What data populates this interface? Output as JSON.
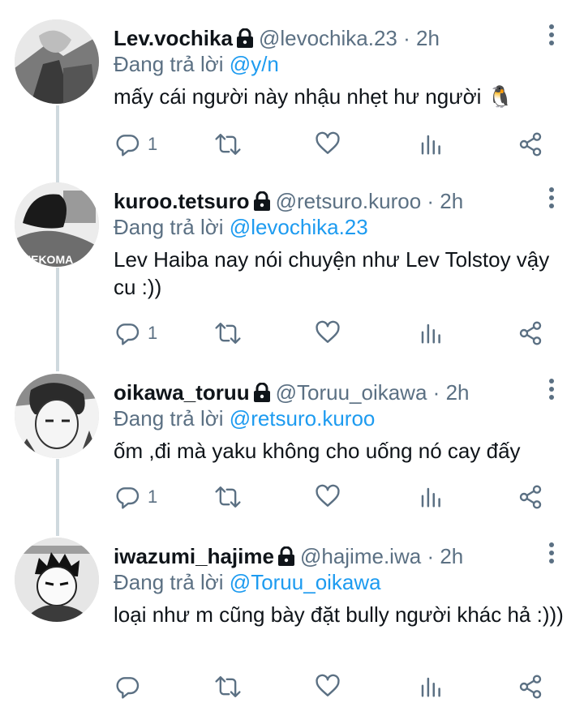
{
  "colors": {
    "accent": "#1d9bf0",
    "secondary_text": "#5b7083",
    "thread_line": "#cfd9de",
    "icon": "#5b7083"
  },
  "tweets": [
    {
      "display_name": "Lev.vochika",
      "handle": "@levochika.23",
      "separator": "·",
      "time": "2h",
      "replying_prefix": "Đang trả lời",
      "replying_to": "@y/n",
      "text": "mấy cái người này nhậu nhẹt hư người 🐧",
      "reply_count": "1",
      "icons": [
        "lock-icon",
        "more-icon",
        "reply-icon",
        "retweet-icon",
        "like-icon",
        "analytics-icon",
        "share-icon"
      ]
    },
    {
      "display_name": "kuroo.tetsuro",
      "handle": "@retsuro.kuroo",
      "separator": "·",
      "time": "2h",
      "replying_prefix": "Đang trả lời",
      "replying_to": "@levochika.23",
      "text": "Lev Haiba nay nói chuyện như Lev Tolstoy vậy cu :))",
      "reply_count": "1",
      "icons": [
        "lock-icon",
        "more-icon",
        "reply-icon",
        "retweet-icon",
        "like-icon",
        "analytics-icon",
        "share-icon"
      ]
    },
    {
      "display_name": "oikawa_toruu",
      "handle": "@Toruu_oikawa",
      "separator": "·",
      "time": "2h",
      "replying_prefix": "Đang trả lời",
      "replying_to": "@retsuro.kuroo",
      "text": "ốm ,đi mà yaku không cho uống nó cay đấy",
      "reply_count": "1",
      "icons": [
        "lock-icon",
        "more-icon",
        "reply-icon",
        "retweet-icon",
        "like-icon",
        "analytics-icon",
        "share-icon"
      ]
    },
    {
      "display_name": "iwazumi_hajime",
      "handle": "@hajime.iwa",
      "separator": "·",
      "time": "2h",
      "replying_prefix": "Đang trả lời",
      "replying_to": "@Toruu_oikawa",
      "text": "loại như m cũng bày đặt bully người khác hả :)))",
      "reply_count": "",
      "icons": [
        "lock-icon",
        "more-icon",
        "reply-icon",
        "retweet-icon",
        "like-icon",
        "analytics-icon",
        "share-icon"
      ]
    }
  ]
}
